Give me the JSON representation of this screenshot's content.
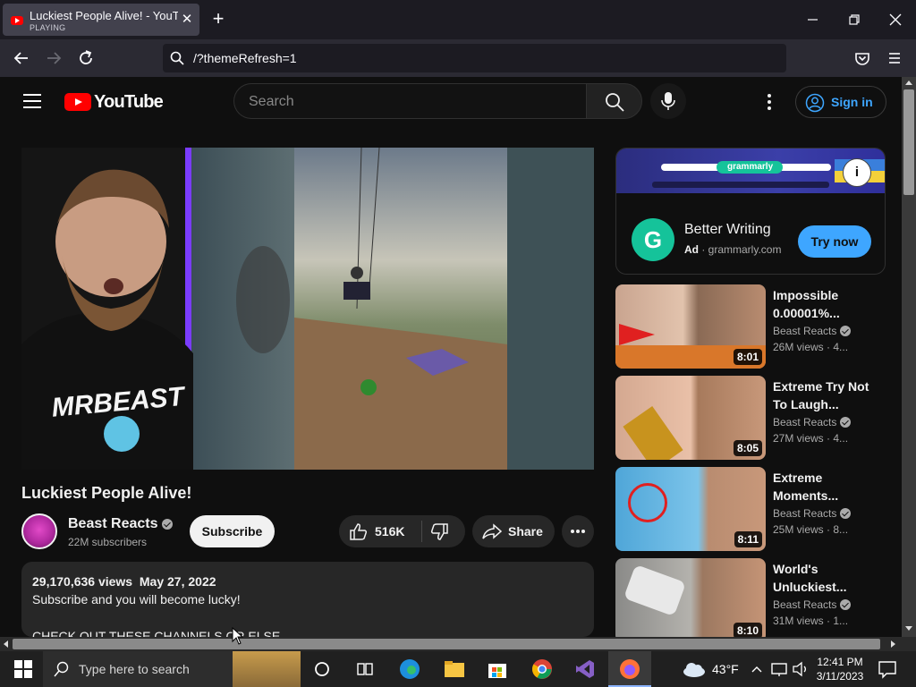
{
  "browser": {
    "tab_title": "Luckiest People Alive! - YouTube",
    "tab_status": "PLAYING",
    "url": "/?themeRefresh=1"
  },
  "youtube": {
    "logo_text": "YouTube",
    "search_placeholder": "Search",
    "signin_label": "Sign in"
  },
  "video": {
    "title": "Luckiest People Alive!",
    "channel": "Beast Reacts",
    "subscribers": "22M subscribers",
    "subscribe_label": "Subscribe",
    "likes": "516K",
    "share_label": "Share",
    "views": "29,170,636 views",
    "date": "May 27, 2022",
    "desc_line1": "Subscribe and you will become lucky!",
    "desc_line2": "CHECK OUT THESE CHANNELS OR ELSE"
  },
  "ad": {
    "title": "Better Writing",
    "label": "Ad",
    "domain": "grammarly.com",
    "cta": "Try now",
    "banner_brand": "grammarly"
  },
  "related": [
    {
      "title": "Impossible 0.00001%...",
      "channel": "Beast Reacts",
      "meta": "26M views · 4...",
      "duration": "8:01"
    },
    {
      "title": "Extreme Try Not To Laugh...",
      "channel": "Beast Reacts",
      "meta": "27M views · 4...",
      "duration": "8:05"
    },
    {
      "title": "Extreme Moments...",
      "channel": "Beast Reacts",
      "meta": "25M views · 8...",
      "duration": "8:11"
    },
    {
      "title": "World's Unluckiest...",
      "channel": "Beast Reacts",
      "meta": "31M views · 1...",
      "duration": "8:10"
    }
  ],
  "taskbar": {
    "search_placeholder": "Type here to search",
    "temperature": "43°F",
    "time": "12:41 PM",
    "date": "3/11/2023"
  },
  "colors": {
    "youtube_red": "#ff0000",
    "link_blue": "#3ea6ff",
    "grammarly_green": "#15c39a"
  }
}
